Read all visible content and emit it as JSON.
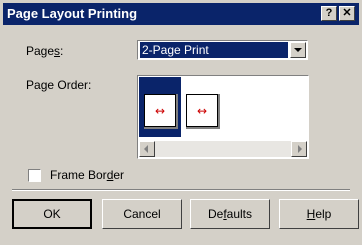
{
  "window": {
    "title": "Page Layout Printing",
    "help_glyph": "?",
    "close_glyph": "✕"
  },
  "pages": {
    "label_pre": "Page",
    "label_ul": "s",
    "label_post": ":",
    "value": "2-Page Print"
  },
  "page_order": {
    "label_pre": "Pa",
    "label_ul": "g",
    "label_post": "e Order:",
    "arrow_glyph": "↔"
  },
  "frame_border": {
    "label_pre": "Frame Bor",
    "label_ul": "d",
    "label_post": "er",
    "checked": false
  },
  "buttons": {
    "ok": "OK",
    "cancel": "Cancel",
    "defaults_pre": "De",
    "defaults_ul": "f",
    "defaults_post": "aults",
    "help_ul": "H",
    "help_post": "elp"
  },
  "colors": {
    "selection": "#0a246a",
    "face": "#d4d0c8",
    "arrow": "#cc0000"
  }
}
